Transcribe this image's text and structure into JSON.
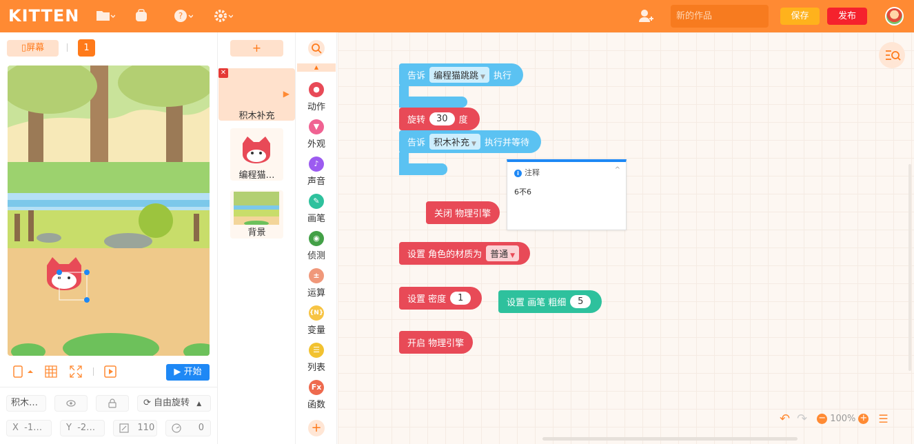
{
  "app": {
    "logo": "KITTEN"
  },
  "header": {
    "project_name_placeholder": "新的作品",
    "save_label": "保存",
    "publish_label": "发布"
  },
  "stage_panel": {
    "screen_label": "屏幕",
    "scene_number": "1",
    "start_label": "开始",
    "props": {
      "sprite_name": "积木…",
      "rotation_mode": "自由旋转",
      "x_label": "X",
      "x_value": "-1…",
      "y_label": "Y",
      "y_value": "-2…",
      "size_value": "110",
      "direction_value": "0"
    }
  },
  "sprites": {
    "add_label": "+",
    "items": [
      {
        "label": "积木补充"
      },
      {
        "label": "编程猫…"
      },
      {
        "label": "背景"
      }
    ]
  },
  "categories": [
    {
      "label": "动作",
      "color": "#e84a57",
      "icon": "motion-icon"
    },
    {
      "label": "外观",
      "color": "#f06292",
      "icon": "shirt-icon"
    },
    {
      "label": "声音",
      "color": "#9c5bf0",
      "icon": "music-icon"
    },
    {
      "label": "画笔",
      "color": "#2ec19d",
      "icon": "pen-icon"
    },
    {
      "label": "侦测",
      "color": "#43a047",
      "icon": "detect-icon"
    },
    {
      "label": "运算",
      "color": "#f0987a",
      "icon": "calc-icon"
    },
    {
      "label": "变量",
      "color": "#f7c444",
      "icon": "variable-icon",
      "glyph": "{N}"
    },
    {
      "label": "列表",
      "color": "#f2c230",
      "icon": "list-icon"
    },
    {
      "label": "函数",
      "color": "#ee6a4e",
      "icon": "function-icon",
      "glyph": "Fx"
    }
  ],
  "blocks": {
    "tell1": {
      "prefix": "告诉",
      "target": "编程猫跳跳",
      "suffix": "执行"
    },
    "rotate": {
      "prefix": "旋转",
      "value": "30",
      "suffix": "度"
    },
    "tell2": {
      "prefix": "告诉",
      "target": "积木补充",
      "suffix": "执行并等待"
    },
    "physics_off": {
      "label": "关闭 物理引擎"
    },
    "material": {
      "prefix": "设置 角色的材质为",
      "value": "普通"
    },
    "density": {
      "prefix": "设置 密度",
      "value": "1"
    },
    "pen_width": {
      "prefix": "设置 画笔 粗细",
      "value": "5"
    },
    "physics_on": {
      "label": "开启 物理引擎"
    }
  },
  "note": {
    "title": "注释",
    "body": "6不6"
  },
  "zoom": {
    "level": "100%"
  }
}
